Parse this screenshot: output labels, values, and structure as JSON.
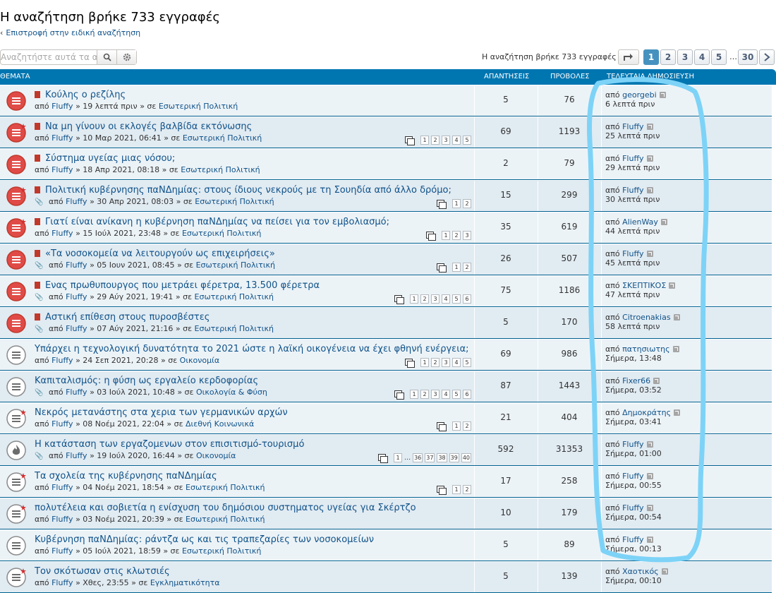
{
  "header": {
    "title": "Η αναζήτηση βρήκε 733 εγγραφές",
    "back": "Επιστροφή στην ειδική αναζήτηση"
  },
  "search": {
    "placeholder": "Αναζητήστε αυτά τα απ",
    "search_icon": "search-icon",
    "settings_icon": "gear-icon"
  },
  "pagination": {
    "status": "Η αναζήτηση βρήκε 733 εγγραφές",
    "pages": [
      "1",
      "2",
      "3",
      "4",
      "5"
    ],
    "ellipsis": "…",
    "last": "30",
    "current": "1"
  },
  "columns": {
    "topics": "ΘΕΜΑΤΑ",
    "replies": "ΑΠΑΝΤΗΣΕΙΣ",
    "views": "ΠΡΟΒΟΛΕΣ",
    "last": "ΤΕΛΕΥΤΑΙΑ ΔΗΜΟΣΙΕΥΣΗ"
  },
  "topics": [
    {
      "icon": "hot-red",
      "flag": true,
      "clip": false,
      "title": "Κούλης ο ρεζίλης",
      "by": "από",
      "author": "Fluffy",
      "when": "» 19 λεπτά πριν",
      "forum_pre": "» σε",
      "forum": "Εσωτερική Πολιτική",
      "pages": [],
      "replies": "5",
      "views": "76",
      "last_author": "georgebi",
      "last_time": "6 λεπτά πριν"
    },
    {
      "icon": "hot-red-star",
      "flag": true,
      "clip": false,
      "title": "Να μη γίνουν οι εκλογές βαλβίδα εκτόνωσης",
      "by": "από",
      "author": "Fluffy",
      "when": "» 10 Μαρ 2021, 06:41",
      "forum_pre": "» σε",
      "forum": "Εσωτερική Πολιτική",
      "pages": [
        "1",
        "2",
        "3",
        "4",
        "5"
      ],
      "replies": "69",
      "views": "1193",
      "last_author": "Fluffy",
      "last_time": "25 λεπτά πριν"
    },
    {
      "icon": "hot-red",
      "flag": true,
      "clip": false,
      "title": "Σύστημα υγείας μιας νόσου;",
      "by": "από",
      "author": "Fluffy",
      "when": "» 18 Απρ 2021, 08:18",
      "forum_pre": "» σε",
      "forum": "Εσωτερική Πολιτική",
      "pages": [],
      "replies": "2",
      "views": "79",
      "last_author": "Fluffy",
      "last_time": "29 λεπτά πριν"
    },
    {
      "icon": "hot-red-star",
      "flag": true,
      "clip": true,
      "title": "Πολιτική κυβέρνησης παΝΔημίας: στους ίδιους νεκρούς με τη Σουηδία από άλλο δρόμο;",
      "by": "από",
      "author": "Fluffy",
      "when": "» 30 Απρ 2021, 08:03",
      "forum_pre": "» σε",
      "forum": "Εσωτερική Πολιτική",
      "pages": [
        "1",
        "2"
      ],
      "replies": "15",
      "views": "299",
      "last_author": "Fluffy",
      "last_time": "30 λεπτά πριν"
    },
    {
      "icon": "hot-red-star",
      "flag": true,
      "clip": false,
      "title": "Γιατί είναι ανίκανη η κυβέρνηση παΝΔημίας να πείσει για τον εμβολιασμό;",
      "by": "από",
      "author": "Fluffy",
      "when": "» 15 Ιούλ 2021, 23:48",
      "forum_pre": "» σε",
      "forum": "Εσωτερική Πολιτική",
      "pages": [
        "1",
        "2",
        "3"
      ],
      "replies": "35",
      "views": "619",
      "last_author": "AlienWay",
      "last_time": "44 λεπτά πριν"
    },
    {
      "icon": "hot-red",
      "flag": true,
      "clip": true,
      "title": "«Τα νοσοκομεία να λειτουργούν ως επιχειρήσεις»",
      "by": "από",
      "author": "Fluffy",
      "when": "» 05 Ιουν 2021, 08:45",
      "forum_pre": "» σε",
      "forum": "Εσωτερική Πολιτική",
      "pages": [
        "1",
        "2"
      ],
      "replies": "26",
      "views": "507",
      "last_author": "Fluffy",
      "last_time": "45 λεπτά πριν"
    },
    {
      "icon": "hot-red",
      "flag": true,
      "clip": true,
      "title": "Ενας πρωθυπουργος που μετράει φέρετρα, 13.500 φέρετρα",
      "by": "από",
      "author": "Fluffy",
      "when": "» 29 Αύγ 2021, 19:41",
      "forum_pre": "» σε",
      "forum": "Εσωτερική Πολιτική",
      "pages": [
        "1",
        "2",
        "3",
        "4",
        "5",
        "6"
      ],
      "replies": "75",
      "views": "1186",
      "last_author": "ΣΚΕΠΤΙΚΟΣ",
      "last_time": "47 λεπτά πριν"
    },
    {
      "icon": "hot-red",
      "flag": true,
      "clip": true,
      "title": "Αστική επίθεση στους πυροσβέστες",
      "by": "από",
      "author": "Fluffy",
      "when": "» 07 Αύγ 2021, 21:16",
      "forum_pre": "» σε",
      "forum": "Εσωτερική Πολιτική",
      "pages": [],
      "replies": "5",
      "views": "170",
      "last_author": "Citroenakias",
      "last_time": "58 λεπτά πριν"
    },
    {
      "icon": "read",
      "flag": false,
      "clip": false,
      "title": "Υπάρχει η τεχνολογική δυνατότητα το 2021 ώστε η λαϊκή οικογένεια να έχει φθηνή ενέργεια;",
      "by": "από",
      "author": "Fluffy",
      "when": "» 24 Σεπ 2021, 20:28",
      "forum_pre": "» σε",
      "forum": "Οικονομία",
      "pages": [
        "1",
        "2",
        "3",
        "4",
        "5"
      ],
      "replies": "69",
      "views": "986",
      "last_author": "πατησιωτης",
      "last_time": "Σήμερα, 13:48"
    },
    {
      "icon": "read",
      "flag": false,
      "clip": true,
      "title": "Καπιταλισμός: η φύση ως εργαλείο κερδοφορίας",
      "by": "από",
      "author": "Fluffy",
      "when": "» 03 Ιούλ 2021, 10:48",
      "forum_pre": "» σε",
      "forum": "Οικολογία & Φύση",
      "pages": [
        "1",
        "2",
        "3",
        "4",
        "5",
        "6"
      ],
      "replies": "87",
      "views": "1443",
      "last_author": "Fixer66",
      "last_time": "Σήμερα, 03:52"
    },
    {
      "icon": "read-star",
      "flag": false,
      "clip": false,
      "title": "Νεκρός μετανάστης στα χερια των γερμανικών αρχών",
      "by": "από",
      "author": "Fluffy",
      "when": "» 08 Νοέμ 2021, 22:04",
      "forum_pre": "» σε",
      "forum": "Διεθνή Κοινωνικά",
      "pages": [
        "1",
        "2"
      ],
      "replies": "21",
      "views": "404",
      "last_author": "Δημοκράτης",
      "last_time": "Σήμερα, 03:41"
    },
    {
      "icon": "fire",
      "flag": false,
      "clip": true,
      "title": "Η κατάσταση των εργαζομενων στον επισιτισμό-τουρισμό",
      "by": "από",
      "author": "Fluffy",
      "when": "» 19 Ιούλ 2020, 16:44",
      "forum_pre": "» σε",
      "forum": "Οικονομία",
      "pages": [
        "1",
        "…",
        "36",
        "37",
        "38",
        "39",
        "40"
      ],
      "replies": "592",
      "views": "31353",
      "last_author": "Fluffy",
      "last_time": "Σήμερα, 01:00"
    },
    {
      "icon": "read-star",
      "flag": false,
      "clip": false,
      "title": "Τα σχολεία της κυβέρνησης παΝΔημίας",
      "by": "από",
      "author": "Fluffy",
      "when": "» 04 Νοέμ 2021, 18:54",
      "forum_pre": "» σε",
      "forum": "Εσωτερική Πολιτική",
      "pages": [
        "1",
        "2"
      ],
      "replies": "17",
      "views": "258",
      "last_author": "Fluffy",
      "last_time": "Σήμερα, 00:55"
    },
    {
      "icon": "read-star",
      "flag": false,
      "clip": false,
      "title": "πολυτέλεια και σοβιετία η ενίσχυση του δημόσιου συστηματος υγείας για Σκέρτζο",
      "by": "από",
      "author": "Fluffy",
      "when": "» 03 Νοέμ 2021, 20:39",
      "forum_pre": "» σε",
      "forum": "Εσωτερική Πολιτική",
      "pages": [],
      "replies": "10",
      "views": "179",
      "last_author": "Fluffy",
      "last_time": "Σήμερα, 00:54"
    },
    {
      "icon": "read",
      "flag": false,
      "clip": false,
      "title": "Κυβέρνηση παΝΔημίας: ράντζα ως και τις τραπεζαρίες των νοσοκομείων",
      "by": "από",
      "author": "Fluffy",
      "when": "» 05 Ιούλ 2021, 18:59",
      "forum_pre": "» σε",
      "forum": "Εσωτερική Πολιτική",
      "pages": [],
      "replies": "5",
      "views": "89",
      "last_author": "Fluffy",
      "last_time": "Σήμερα, 00:13"
    },
    {
      "icon": "read-star",
      "flag": false,
      "clip": false,
      "title": "Τον σκότωσαν στις κλωτσιές",
      "by": "από",
      "author": "Fluffy",
      "when": "» Χθες, 23:55",
      "forum_pre": "» σε",
      "forum": "Εγκληματικότητα",
      "pages": [],
      "replies": "5",
      "views": "139",
      "last_author": "Χαοτικός",
      "last_time": "Σήμερα, 00:10"
    }
  ],
  "colors": {
    "header": "#0076b1",
    "link": "#105289",
    "annotation": "#7dd3f7"
  }
}
